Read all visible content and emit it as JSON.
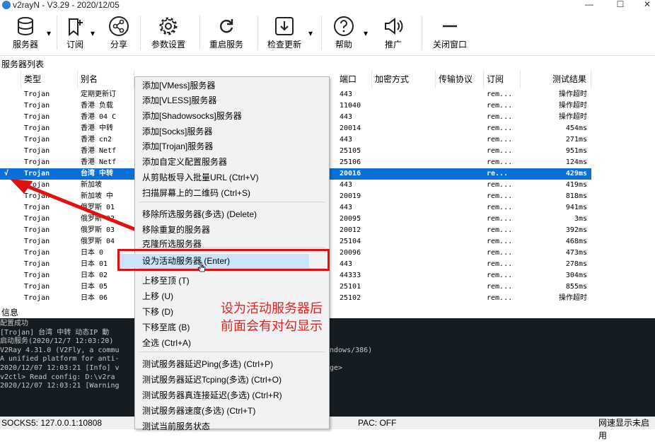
{
  "window": {
    "title": "v2rayN - V3.29 - 2020/12/05",
    "minimize": "—",
    "maximize": "☐",
    "close": "✕"
  },
  "toolbar": [
    {
      "id": "servers",
      "label": "服务器",
      "icon": "database-icon",
      "dropdown": true
    },
    {
      "id": "subscribe",
      "label": "订阅",
      "icon": "subscribe-icon",
      "dropdown": true
    },
    {
      "id": "share",
      "label": "分享",
      "icon": "share-icon",
      "dropdown": false
    },
    {
      "id": "settings",
      "label": "参数设置",
      "icon": "gear-icon",
      "dropdown": false
    },
    {
      "id": "restart",
      "label": "重启服务",
      "icon": "refresh-icon",
      "dropdown": false
    },
    {
      "id": "update",
      "label": "检查更新",
      "icon": "download-icon",
      "dropdown": true
    },
    {
      "id": "help",
      "label": "帮助",
      "icon": "help-icon",
      "dropdown": true
    },
    {
      "id": "promote",
      "label": "推广",
      "icon": "speaker-icon",
      "dropdown": false
    },
    {
      "id": "close",
      "label": "关闭窗口",
      "icon": "minus-icon",
      "dropdown": false
    }
  ],
  "list": {
    "label": "服务器列表",
    "columns": [
      "类型",
      "别名",
      "",
      "",
      "端口",
      "加密方式",
      "传输协议",
      "订阅",
      "测试结果"
    ],
    "rows": [
      {
        "check": "",
        "type": "Trojan",
        "alias": "定期更新订",
        "port": "443",
        "sub": "rem...",
        "result": "操作超时"
      },
      {
        "check": "",
        "type": "Trojan",
        "alias": "香港 负载",
        "port": "11040",
        "sub": "rem...",
        "result": "操作超时"
      },
      {
        "check": "",
        "type": "Trojan",
        "alias": "香港 04 C",
        "port": "443",
        "sub": "rem...",
        "result": "操作超时"
      },
      {
        "check": "",
        "type": "Trojan",
        "alias": "香港 中转",
        "port": "20014",
        "sub": "rem...",
        "result": "454ms"
      },
      {
        "check": "",
        "type": "Trojan",
        "alias": "香港 cn2",
        "port": "443",
        "sub": "rem...",
        "result": "271ms"
      },
      {
        "check": "",
        "type": "Trojan",
        "alias": "香港 Netf",
        "port": "25105",
        "sub": "rem...",
        "result": "951ms"
      },
      {
        "check": "",
        "type": "Trojan",
        "alias": "香港 Netf",
        "port": "25106",
        "sub": "rem...",
        "result": "124ms"
      },
      {
        "check": "√",
        "type": "Trojan",
        "alias": "台湾 中转",
        "port": "20016",
        "sub": "re...",
        "result": "429ms",
        "selected": true
      },
      {
        "check": "",
        "type": "Trojan",
        "alias": "新加坡",
        "port": "443",
        "sub": "rem...",
        "result": "419ms"
      },
      {
        "check": "",
        "type": "Trojan",
        "alias": "新加坡 中",
        "port": "20019",
        "sub": "rem...",
        "result": "818ms"
      },
      {
        "check": "",
        "type": "Trojan",
        "alias": "俄罗斯 01",
        "port": "443",
        "sub": "rem...",
        "result": "941ms"
      },
      {
        "check": "",
        "type": "Trojan",
        "alias": "俄罗斯 02",
        "port": "20095",
        "sub": "rem...",
        "result": "3ms"
      },
      {
        "check": "",
        "type": "Trojan",
        "alias": "俄罗斯 03",
        "port": "20012",
        "sub": "rem...",
        "result": "392ms"
      },
      {
        "check": "",
        "type": "Trojan",
        "alias": "俄罗斯 04",
        "port": "25104",
        "sub": "rem...",
        "result": "468ms"
      },
      {
        "check": "",
        "type": "Trojan",
        "alias": "日本 0",
        "port": "20096",
        "sub": "rem...",
        "result": "473ms"
      },
      {
        "check": "",
        "type": "Trojan",
        "alias": "日本 01",
        "port": "443",
        "sub": "rem...",
        "result": "278ms"
      },
      {
        "check": "",
        "type": "Trojan",
        "alias": "日本 02",
        "port": "44333",
        "sub": "rem...",
        "result": "304ms"
      },
      {
        "check": "",
        "type": "Trojan",
        "alias": "日本 05",
        "port": "25101",
        "sub": "rem...",
        "result": "855ms"
      },
      {
        "check": "",
        "type": "Trojan",
        "alias": "日本 06",
        "port": "25102",
        "sub": "rem...",
        "result": "操作超时"
      }
    ]
  },
  "info": {
    "label": "信息",
    "log": [
      "配置成功",
      "[Trojan] 台湾 中转 动态IP 動",
      "启动服务(2020/12/7 12:03:20)",
      "V2Ray 4.31.0 (V2Fly, a commu",
      "A unified platform for anti-",
      "2020/12/07 12:03:21 [Info] v",
      "v2ctl> Read config:  D:\\v2ra",
      "2020/12/07 12:03:21 [Warning"
    ],
    "log_tail": [
      "ndows/386)",
      "ge>"
    ]
  },
  "status": {
    "socks": "SOCKS5:  127.0.0.1:10808",
    "pac": "PAC:  OFF",
    "speed": "网速显示未启用"
  },
  "menu": {
    "items": [
      "添加[VMess]服务器",
      "添加[VLESS]服务器",
      "添加[Shadowsocks]服务器",
      "添加[Socks]服务器",
      "添加[Trojan]服务器",
      "添加自定义配置服务器",
      "从剪贴板导入批量URL (Ctrl+V)",
      "扫描屏幕上的二维码 (Ctrl+S)",
      "移除所选服务器(多选) (Delete)",
      "移除重复的服务器",
      "克隆所选服务器",
      "设为活动服务器 (Enter)",
      "上移至顶 (T)",
      "上移 (U)",
      "下移 (D)",
      "下移至底 (B)",
      "全选 (Ctrl+A)",
      "测试服务器延迟Ping(多选) (Ctrl+P)",
      "测试服务器延迟Tcping(多选) (Ctrl+O)",
      "测试服务器真连接延迟(多选) (Ctrl+R)",
      "测试服务器速度(多选) (Ctrl+T)",
      "测试当前服务状态"
    ]
  },
  "annotation": [
    "设为活动服务器后",
    "前面会有对勾显示"
  ],
  "colors": {
    "selected_row": "#0a6fd6",
    "highlight": "#cce4f7",
    "annotation": "#e52020",
    "log_bg": "#151d22"
  }
}
